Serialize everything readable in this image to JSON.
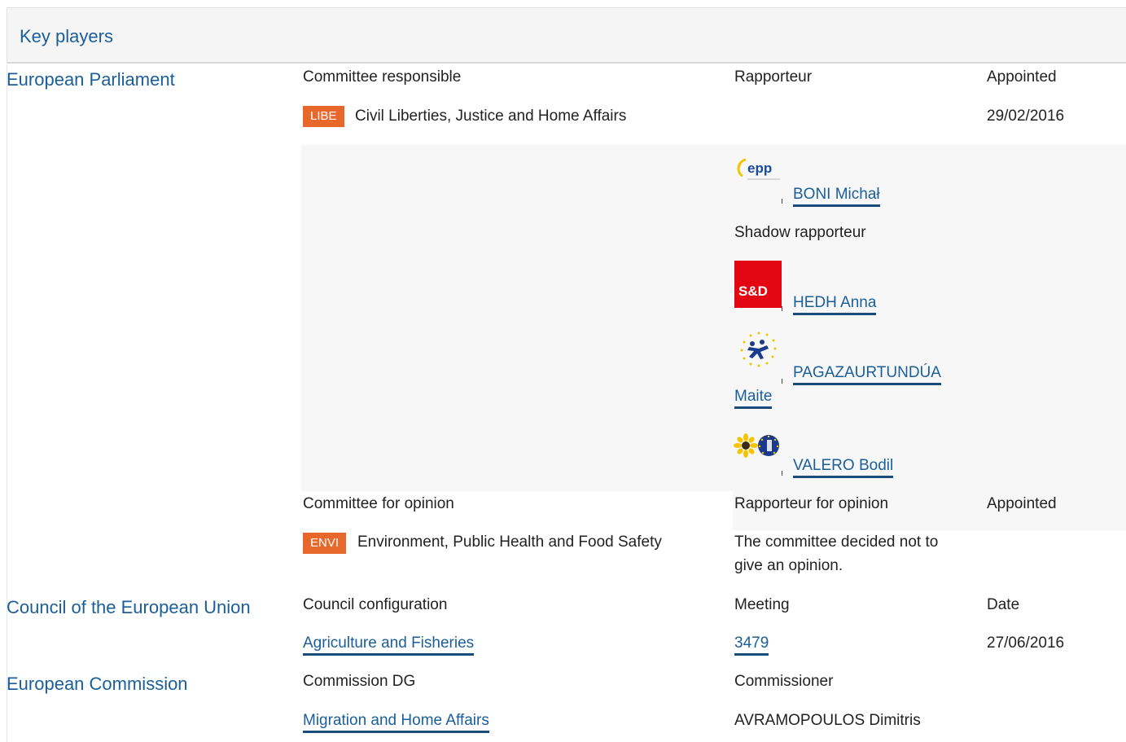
{
  "header": {
    "title": "Key players"
  },
  "ep": {
    "name": "European Parliament",
    "col_committee": "Committee responsible",
    "col_rapporteur": "Rapporteur",
    "col_appointed": "Appointed",
    "committee": {
      "code": "LIBE",
      "name": "Civil Liberties, Justice and Home Affairs",
      "appointed": "29/02/2016"
    },
    "rapporteur": {
      "name": "BONI Michał",
      "group_logo": "epp-logo"
    },
    "shadow_label": "Shadow rapporteur",
    "shadows": [
      {
        "name": "HEDH Anna",
        "group_logo": "s-and-d-logo",
        "logo_text": "S&D"
      },
      {
        "name_line1": "PAGAZAURTUNDÚA",
        "name_line2": "Maite",
        "group_logo": "alde-logo"
      },
      {
        "name": "VALERO Bodil",
        "group_logo": "greens-efa-logo"
      }
    ],
    "opinion_col_committee": "Committee for opinion",
    "opinion_col_rapporteur": "Rapporteur for opinion",
    "opinion_col_appointed": "Appointed",
    "opinion_committee": {
      "code": "ENVI",
      "name": "Environment, Public Health and Food Safety"
    },
    "opinion_note_line1": "The committee decided not to",
    "opinion_note_line2": "give an opinion.",
    "colors": {
      "link": "#1a5e9a",
      "badge": "#e8682c"
    }
  },
  "council": {
    "name": "Council of the European Union",
    "col_config": "Council configuration",
    "col_meeting": "Meeting",
    "col_date": "Date",
    "config": "Agriculture and Fisheries",
    "meeting": "3479",
    "date": "27/06/2016"
  },
  "commission": {
    "name": "European Commission",
    "col_dg": "Commission DG",
    "col_commissioner": "Commissioner",
    "dg": "Migration and Home Affairs",
    "commissioner": "AVRAMOPOULOS Dimitris"
  }
}
